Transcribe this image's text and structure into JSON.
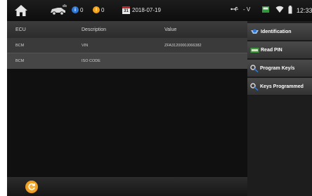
{
  "topbar": {
    "info_count": "0",
    "warning_count": "0",
    "calendar_day": "31",
    "date": "2018-07-19",
    "voltage": "- V",
    "time": "12:33"
  },
  "table": {
    "headers": [
      "ECU",
      "Description",
      "Value"
    ],
    "rows": [
      [
        "BCM",
        "VIN",
        "ZFA3120000J066382"
      ],
      [
        "BCM",
        "ISO CODE",
        ""
      ]
    ]
  },
  "panel": {
    "buttons": [
      {
        "label": "Identification",
        "icon": "info-icon"
      },
      {
        "label": "Read PIN",
        "icon": "pin-icon"
      },
      {
        "label": "Program Key/s",
        "icon": "key-icon"
      },
      {
        "label": "Keys Programmed",
        "icon": "key-icon"
      }
    ]
  },
  "colors": {
    "accent_orange": "#f5a21c",
    "info_blue": "#2f78d8",
    "calendar_red": "#c0282a"
  }
}
